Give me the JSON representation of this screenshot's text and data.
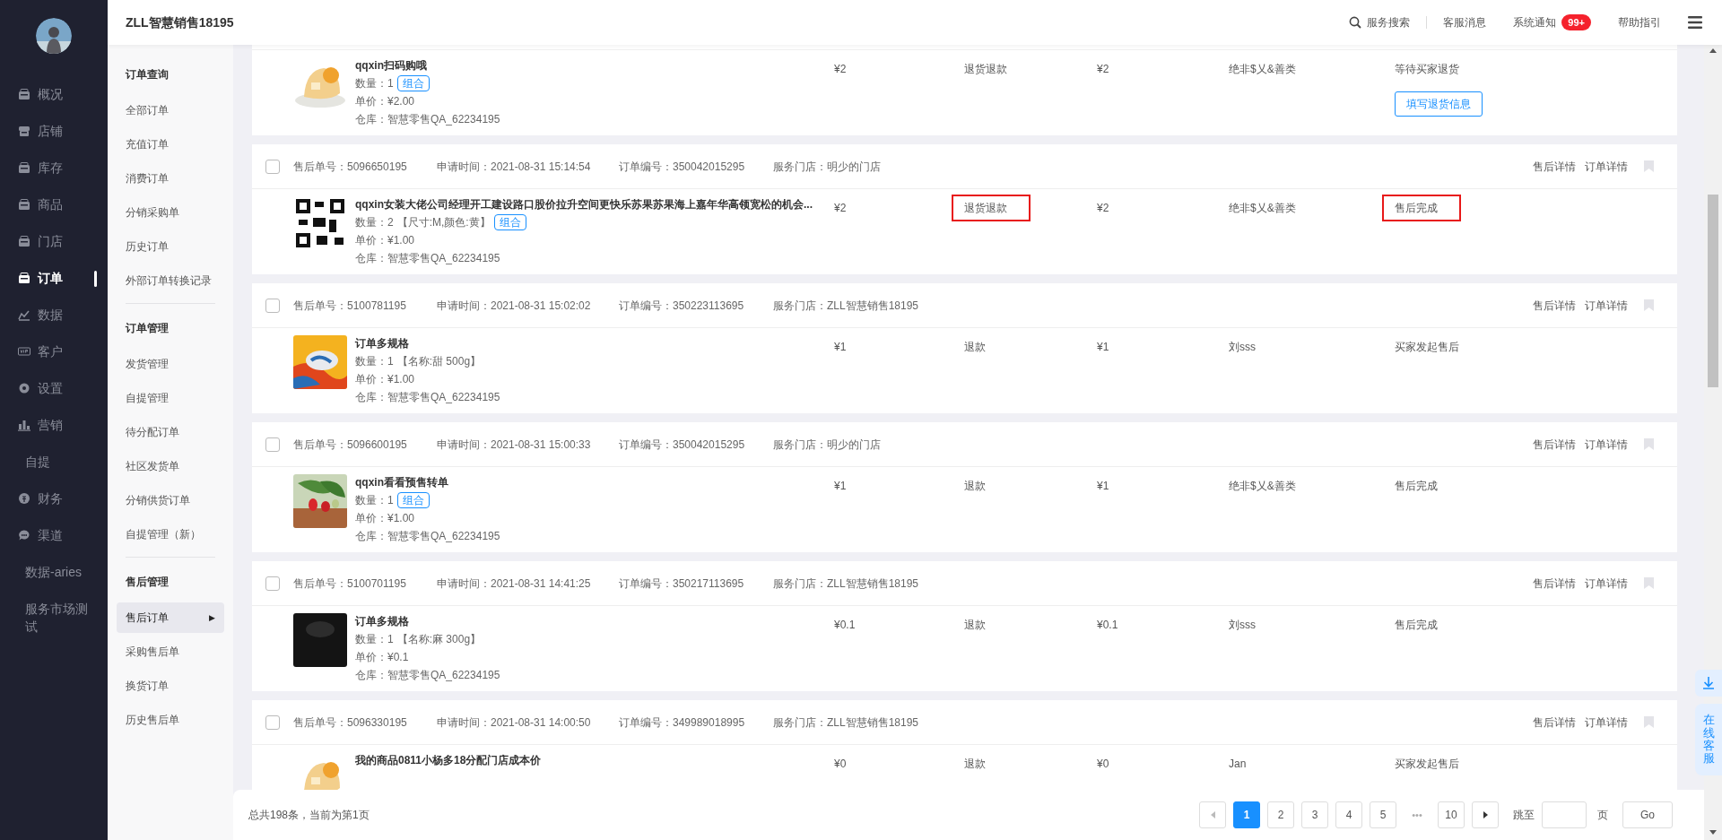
{
  "nav": {
    "items": [
      {
        "label": "概况",
        "selected": false
      },
      {
        "label": "店铺",
        "selected": false
      },
      {
        "label": "库存",
        "selected": false
      },
      {
        "label": "商品",
        "selected": false
      },
      {
        "label": "门店",
        "selected": false
      },
      {
        "label": "订单",
        "selected": true
      },
      {
        "label": "数据",
        "selected": false
      },
      {
        "label": "客户",
        "selected": false
      },
      {
        "label": "设置",
        "selected": false
      },
      {
        "label": "营销",
        "selected": false
      },
      {
        "label": "自提",
        "selected": false
      },
      {
        "label": "财务",
        "selected": false
      },
      {
        "label": "渠道",
        "selected": false
      },
      {
        "label": "数据-aries",
        "selected": false
      },
      {
        "label": "服务市场测试",
        "selected": false
      }
    ]
  },
  "header": {
    "title": "ZLL智慧销售18195",
    "search": "服务搜索",
    "links": [
      "客服消息",
      "系统通知",
      "帮助指引"
    ],
    "badge": "99+"
  },
  "submenu": [
    {
      "title": "订单查询",
      "items": [
        {
          "label": "全部订单",
          "selected": false
        },
        {
          "label": "充值订单",
          "selected": false
        },
        {
          "label": "消费订单",
          "selected": false
        },
        {
          "label": "分销采购单",
          "selected": false
        },
        {
          "label": "历史订单",
          "selected": false
        },
        {
          "label": "外部订单转换记录",
          "selected": false
        }
      ]
    },
    {
      "title": "订单管理",
      "items": [
        {
          "label": "发货管理",
          "selected": false
        },
        {
          "label": "自提管理",
          "selected": false
        },
        {
          "label": "待分配订单",
          "selected": false
        },
        {
          "label": "社区发货单",
          "selected": false
        },
        {
          "label": "分销供货订单",
          "selected": false
        },
        {
          "label": "自提管理（新）",
          "selected": false
        }
      ]
    },
    {
      "title": "售后管理",
      "items": [
        {
          "label": "售后订单",
          "selected": true,
          "arrow": "▶"
        },
        {
          "label": "采购售后单",
          "selected": false
        },
        {
          "label": "换货订单",
          "selected": false
        },
        {
          "label": "历史售后单",
          "selected": false
        }
      ]
    }
  ],
  "orders": [
    {
      "product": {
        "title": "qqxin扫码购哦",
        "qty": "数量：1",
        "tag": "组合",
        "price_line": "单价：¥2.00",
        "warehouse": "仓库：智慧零售QA_62234195"
      },
      "price": "¥2",
      "type": {
        "text": "退货退款",
        "highlighted": false
      },
      "refund": "¥2",
      "buyer": "绝非$乂&善类",
      "status": {
        "text": "等待买家退货",
        "highlighted": false
      },
      "action": "填写退货信息"
    },
    {
      "checked": false,
      "meta": [
        "售后单号：5096650195",
        "申请时间：2021-08-31 15:14:54",
        "订单编号：350042015295",
        "服务门店：明少的门店"
      ],
      "links": [
        "售后详情",
        "订单详情"
      ],
      "product": {
        "title": "qqxin女装大佬公司经理开工建设路口股价拉升空间更快乐苏果苏果海上嘉年华高领宽松的机会...",
        "qty": "数量：2",
        "spec": "【尺寸:M,颜色:黄】",
        "tag": "组合",
        "price_line": "单价：¥1.00",
        "warehouse": "仓库：智慧零售QA_62234195"
      },
      "price": "¥2",
      "type": {
        "text": "退货退款",
        "highlighted": true
      },
      "refund": "¥2",
      "buyer": "绝非$乂&善类",
      "status": {
        "text": "售后完成",
        "highlighted": true
      }
    },
    {
      "checked": false,
      "meta": [
        "售后单号：5100781195",
        "申请时间：2021-08-31 15:02:02",
        "订单编号：350223113695",
        "服务门店：ZLL智慧销售18195"
      ],
      "links": [
        "售后详情",
        "订单详情"
      ],
      "product": {
        "title": "订单多规格",
        "qty": "数量：1",
        "spec": "【名称:甜 500g】",
        "price_line": "单价：¥1.00",
        "warehouse": "仓库：智慧零售QA_62234195"
      },
      "price": "¥1",
      "type": {
        "text": "退款",
        "highlighted": false
      },
      "refund": "¥1",
      "buyer": "刘sss",
      "status": {
        "text": "买家发起售后",
        "highlighted": false
      }
    },
    {
      "checked": false,
      "meta": [
        "售后单号：5096600195",
        "申请时间：2021-08-31 15:00:33",
        "订单编号：350042015295",
        "服务门店：明少的门店"
      ],
      "links": [
        "售后详情",
        "订单详情"
      ],
      "product": {
        "title": "qqxin看看预售转单",
        "qty": "数量：1",
        "tag": "组合",
        "price_line": "单价：¥1.00",
        "warehouse": "仓库：智慧零售QA_62234195"
      },
      "price": "¥1",
      "type": {
        "text": "退款",
        "highlighted": false
      },
      "refund": "¥1",
      "buyer": "绝非$乂&善类",
      "status": {
        "text": "售后完成",
        "highlighted": false
      }
    },
    {
      "checked": false,
      "meta": [
        "售后单号：5100701195",
        "申请时间：2021-08-31 14:41:25",
        "订单编号：350217113695",
        "服务门店：ZLL智慧销售18195"
      ],
      "links": [
        "售后详情",
        "订单详情"
      ],
      "product": {
        "title": "订单多规格",
        "qty": "数量：1",
        "spec": "【名称:麻 300g】",
        "price_line": "单价：¥0.1",
        "warehouse": "仓库：智慧零售QA_62234195"
      },
      "price": "¥0.1",
      "type": {
        "text": "退款",
        "highlighted": false
      },
      "refund": "¥0.1",
      "buyer": "刘sss",
      "status": {
        "text": "售后完成",
        "highlighted": false
      }
    },
    {
      "checked": false,
      "meta": [
        "售后单号：5096330195",
        "申请时间：2021-08-31 14:00:50",
        "订单编号：349989018995",
        "服务门店：ZLL智慧销售18195"
      ],
      "links": [
        "售后详情",
        "订单详情"
      ],
      "product": {
        "title": "我的商品0811小杨多18分配门店成本价"
      },
      "price": "¥0",
      "type": {
        "text": "退款",
        "highlighted": false
      },
      "refund": "¥0",
      "buyer": "Jan",
      "status": {
        "text": "买家发起售后",
        "highlighted": false
      }
    }
  ],
  "footer": {
    "summary": "总共198条，当前为第1页",
    "pages": [
      {
        "label": "1",
        "selected": true
      },
      {
        "label": "2",
        "selected": false
      },
      {
        "label": "3",
        "selected": false
      },
      {
        "label": "4",
        "selected": false
      },
      {
        "label": "5",
        "selected": false
      },
      {
        "label": "•••",
        "kind": "ellipsis"
      },
      {
        "label": "10",
        "selected": false
      }
    ],
    "jump_label": "跳至",
    "page_unit": "页",
    "go": "Go"
  },
  "float": {
    "service": "在线客服"
  }
}
